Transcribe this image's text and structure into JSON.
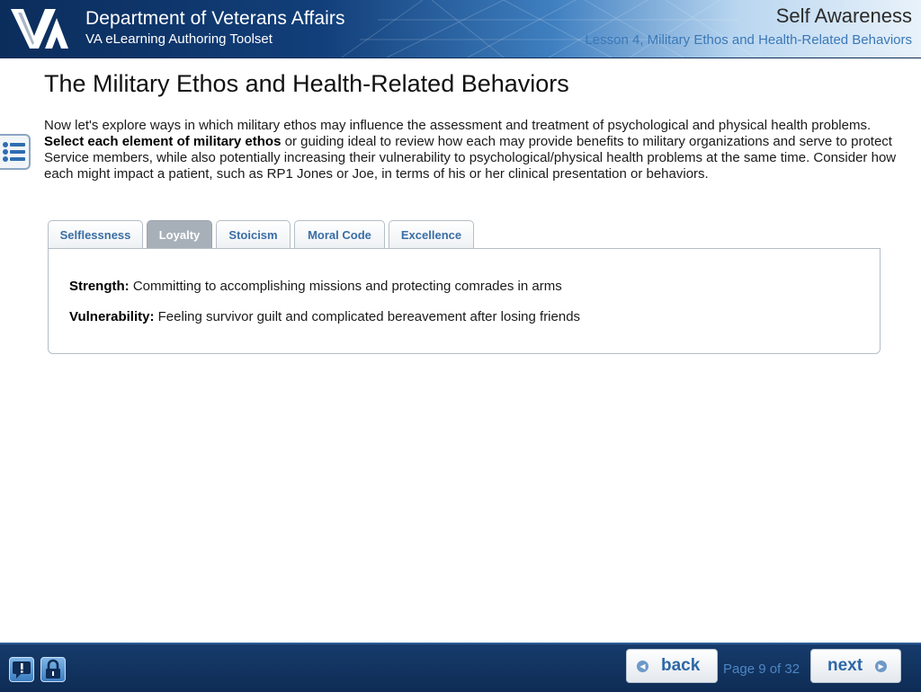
{
  "header": {
    "org_title": "Department of Veterans Affairs",
    "org_subtitle": "VA eLearning Authoring Toolset",
    "course_title": "Self Awareness",
    "lesson_title": "Lesson 4, Military Ethos and Health-Related Behaviors",
    "logo_text": "VA"
  },
  "main": {
    "page_title": "The Military Ethos and Health-Related Behaviors",
    "intro": {
      "part1": "Now let's explore ways in which military ethos may influence the assessment and treatment of psychological and physical health problems. ",
      "bold": "Select each element of military ethos",
      "part2": " or guiding ideal to review how each may provide benefits to military organizations and serve to protect Service members, while also potentially increasing their vulnerability to psychological/physical health problems at the same time. Consider how each might impact a patient, such as RP1 Jones or Joe, in terms of his or her clinical presentation or behaviors."
    },
    "menu_icon": "list-menu-icon"
  },
  "tabs": [
    {
      "label": "Selflessness"
    },
    {
      "label": "Loyalty",
      "active": true
    },
    {
      "label": "Stoicism"
    },
    {
      "label": "Moral Code"
    },
    {
      "label": "Excellence"
    }
  ],
  "panel": {
    "strength_label": "Strength:",
    "strength_text": " Committing to accomplishing missions and protecting comrades in arms",
    "vulnerability_label": "Vulnerability:",
    "vulnerability_text": " Feeling survivor guilt and complicated bereavement after losing friends"
  },
  "footer": {
    "help_icon": "help-icon",
    "lock_icon": "lock-icon",
    "back_label": "back",
    "next_label": "next",
    "page_indicator": "Page 9 of 32"
  },
  "colors": {
    "header_dark": "#0b2d5c",
    "accent_blue": "#3a78b8",
    "tab_active": "#a7b0b9",
    "footer_bg": "#0e2c55"
  }
}
